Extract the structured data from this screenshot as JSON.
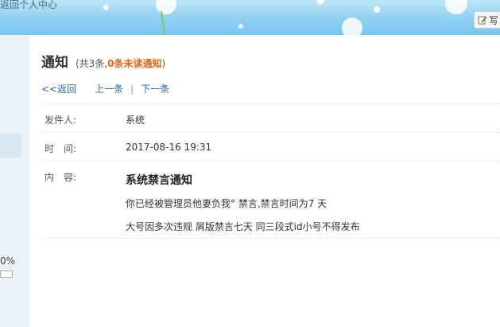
{
  "top": {
    "back_home": "返回个人中心",
    "write_label": "写"
  },
  "sidebar": {
    "percent_text": "0%"
  },
  "header": {
    "title": "通知",
    "count_prefix": "(共3条,",
    "unread_text": "0条未读通知",
    "count_suffix": ")"
  },
  "nav": {
    "back": "<<返回",
    "prev": "上一条",
    "separator": "|",
    "next": "下一条"
  },
  "detail": {
    "sender_label": "发件人:",
    "sender_value": "系统",
    "time_label": "时　间:",
    "time_value": "2017-08-16 19:31",
    "content_label": "内　容:",
    "content_title": "系统禁言通知",
    "content_line1": "你已经被管理员他妻负我° 禁言,禁言时间为7 天",
    "content_line2": "大号因多次违规 屑版禁言七天  同三段式id小号不得发布"
  },
  "colors": {
    "banner_sky": "#8fd0f0",
    "unread_orange": "#e8620f",
    "link_blue": "#2d64b3"
  }
}
